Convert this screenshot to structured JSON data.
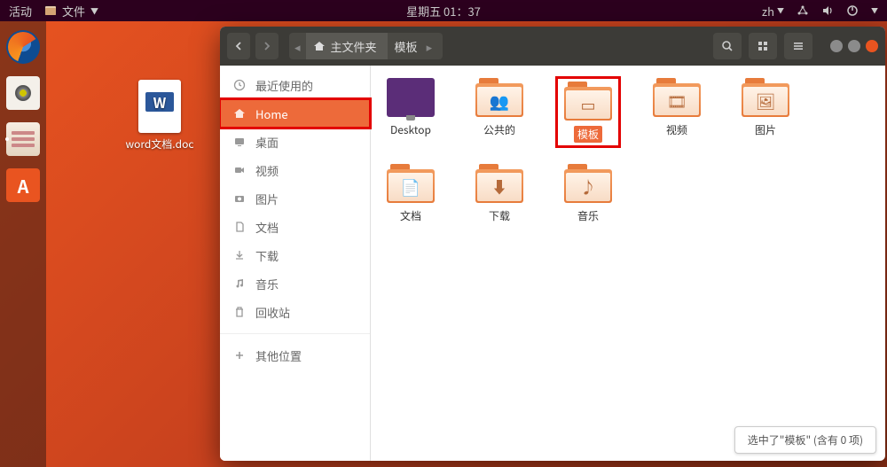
{
  "topbar": {
    "activities": "活动",
    "app_name": "文件",
    "clock": "星期五 01：37",
    "input_method": "zh"
  },
  "desktop": {
    "word_filename": "word文档.doc"
  },
  "filemanager": {
    "path": {
      "home_label": "主文件夹",
      "current": "模板"
    },
    "sidebar": {
      "recent": "最近使用的",
      "home": "Home",
      "desktop": "桌面",
      "videos": "视频",
      "pictures": "图片",
      "documents": "文档",
      "downloads": "下载",
      "music": "音乐",
      "trash": "回收站",
      "other": "其他位置"
    },
    "folders": [
      {
        "key": "desktop",
        "label": "Desktop",
        "glyph": ""
      },
      {
        "key": "public",
        "label": "公共的",
        "glyph": "👥"
      },
      {
        "key": "templates",
        "label": "模板",
        "glyph": "▭"
      },
      {
        "key": "videos",
        "label": "视频",
        "glyph": "🎞"
      },
      {
        "key": "pictures",
        "label": "图片",
        "glyph": "🖼"
      },
      {
        "key": "documents",
        "label": "文档",
        "glyph": "📄"
      },
      {
        "key": "downloads",
        "label": "下载",
        "glyph": "⬇"
      },
      {
        "key": "music",
        "label": "音乐",
        "glyph": "♪"
      }
    ],
    "statusbar": "选中了\"模板\" (含有 0 项)"
  }
}
